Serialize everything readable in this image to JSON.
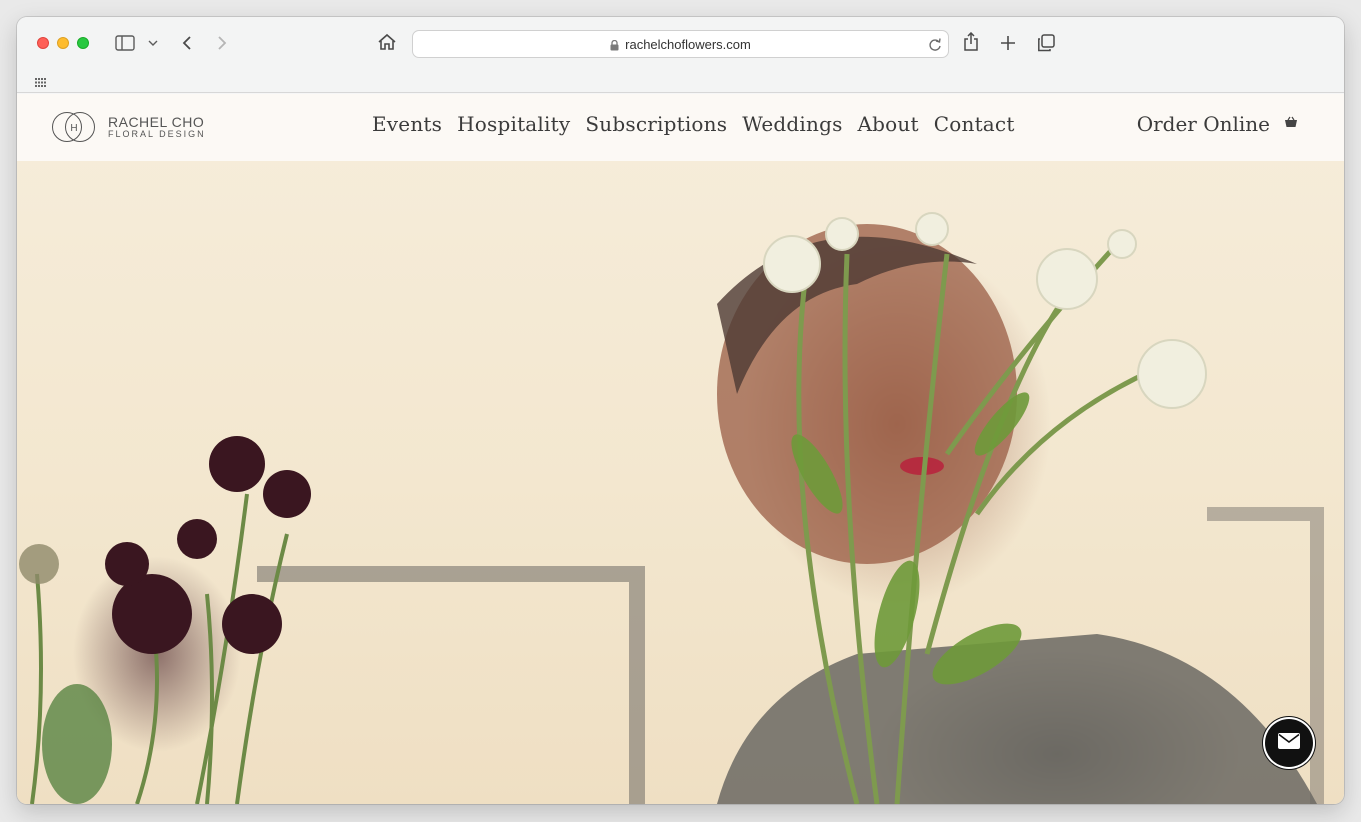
{
  "browser": {
    "url": "rachelchoflowers.com",
    "icons": [
      "sidebar-icon",
      "chevron-down-icon",
      "back-icon",
      "forward-icon",
      "home-icon",
      "lock-icon",
      "reload-icon",
      "share-icon",
      "new-tab-icon",
      "tabs-overview-icon",
      "grid-icon"
    ]
  },
  "site": {
    "logo": {
      "name": "Rachel Cho",
      "subtitle": "Floral Design",
      "monogram": "H"
    },
    "nav": [
      "Events",
      "Hospitality",
      "Subscriptions",
      "Weddings",
      "About",
      "Contact"
    ],
    "order_label": "Order Online",
    "cart_icon": "basket-icon",
    "contact_fab_icon": "mail-icon"
  },
  "colors": {
    "header_bg": "#fcfaf6",
    "nav_text": "#3b3b3b",
    "hero_bg": "#f4e9d3"
  }
}
